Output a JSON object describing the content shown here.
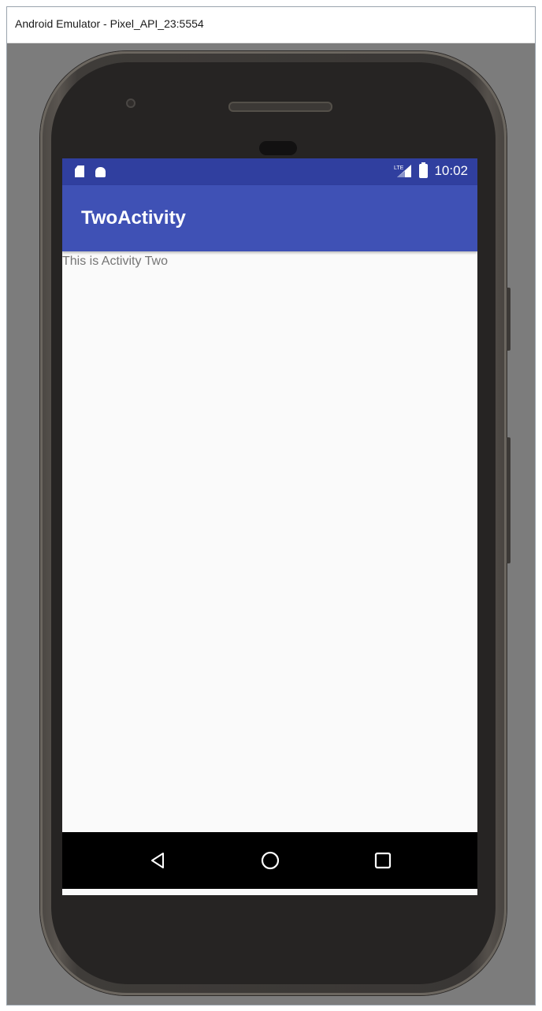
{
  "window": {
    "title": "Android Emulator - Pixel_API_23:5554"
  },
  "statusbar": {
    "left_icons": [
      "sd-card-icon",
      "android-icon"
    ],
    "right_icons": [
      "signal-icon",
      "battery-icon"
    ],
    "clock": "10:02"
  },
  "appbar": {
    "title": "TwoActivity"
  },
  "content": {
    "text": "This is Activity Two"
  },
  "navbar": {
    "buttons": [
      "back-icon",
      "home-icon",
      "recents-icon"
    ]
  },
  "colors": {
    "primary": "#3f51b5",
    "primary_dark": "#303f9f",
    "content_background": "#fafafa",
    "text_secondary": "#757575"
  }
}
